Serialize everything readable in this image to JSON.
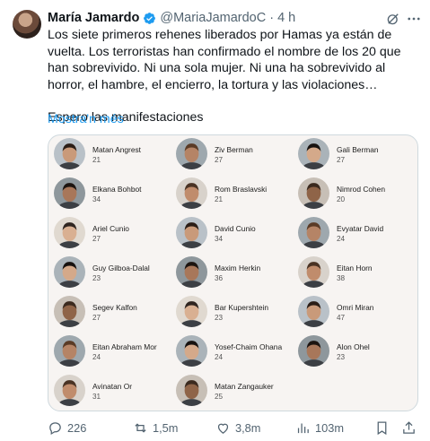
{
  "tweet": {
    "author_name": "María Jamardo",
    "handle": "@MariaJamardoC",
    "separator": "·",
    "time": "4 h",
    "text_lines": [
      "Los siete primeros rehenes liberados por Hamas ya están de vuelta. Los terroristas han confirmado el nombre de los 20 que han sobrevivido. Ni una sola mujer. Ni una ha sobrevivido al horror, el hambre, el encierro, la tortura y las violaciones…",
      "Espero las manifestaciones"
    ],
    "show_more": "Mostra'n més"
  },
  "hostages": [
    {
      "name": "Matan Angrest",
      "age": "21"
    },
    {
      "name": "Ziv Berman",
      "age": "27"
    },
    {
      "name": "Gali Berman",
      "age": "27"
    },
    {
      "name": "Elkana Bohbot",
      "age": "34"
    },
    {
      "name": "Rom Braslavski",
      "age": "21"
    },
    {
      "name": "Nimrod Cohen",
      "age": "20"
    },
    {
      "name": "Ariel Cunio",
      "age": "27"
    },
    {
      "name": "David Cunio",
      "age": "34"
    },
    {
      "name": "Evyatar David",
      "age": "24"
    },
    {
      "name": "Guy Gilboa-Dalal",
      "age": "23"
    },
    {
      "name": "Maxim Herkin",
      "age": "36"
    },
    {
      "name": "Eitan Horn",
      "age": "38"
    },
    {
      "name": "Segev Kalfon",
      "age": "27"
    },
    {
      "name": "Bar Kupershtein",
      "age": "23"
    },
    {
      "name": "Omri Miran",
      "age": "47"
    },
    {
      "name": "Eitan Abraham Mor",
      "age": "24"
    },
    {
      "name": "Yosef-Chaim Ohana",
      "age": "24"
    },
    {
      "name": "Alon Ohel",
      "age": "23"
    },
    {
      "name": "Avinatan Or",
      "age": "31"
    },
    {
      "name": "Matan Zangauker",
      "age": "25"
    }
  ],
  "actions": {
    "replies": "226",
    "reposts": "1,5m",
    "likes": "3,8m",
    "views": "103m"
  },
  "colors": {
    "accent": "#1d9bf0",
    "muted": "#536471",
    "card_bg": "#f7f4f2"
  },
  "icons": [
    "verified-badge-icon",
    "grok-icon",
    "more-icon",
    "reply-icon",
    "repost-icon",
    "like-icon",
    "views-icon",
    "bookmark-icon",
    "share-icon"
  ]
}
